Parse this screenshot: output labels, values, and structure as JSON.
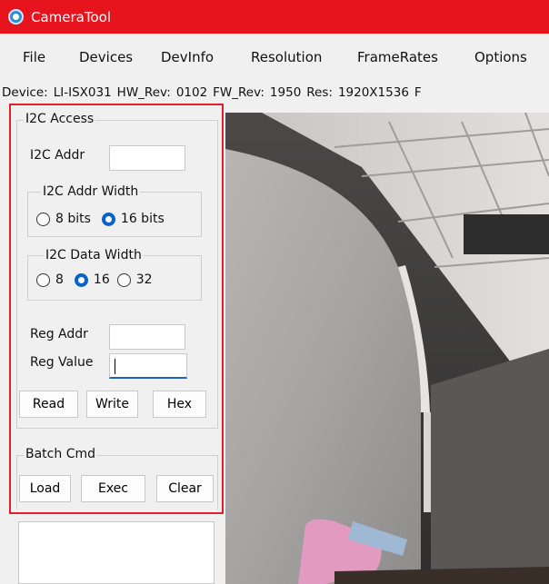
{
  "window": {
    "title": "CameraTool",
    "accent_color": "#e8141d"
  },
  "menu": [
    "File",
    "Devices",
    "DevInfo",
    "Resolution",
    "FrameRates",
    "Options"
  ],
  "info_bar": [
    "Device:",
    "LI-ISX031",
    "HW_Rev:",
    "0102",
    "FW_Rev:",
    "1950",
    "Res:",
    "1920X1536",
    "F"
  ],
  "i2c": {
    "legend": "I2C Access",
    "addr_label": "I2C Addr",
    "addr_value": "",
    "addr_width": {
      "legend": "I2C Addr Width",
      "options": [
        "8 bits",
        "16 bits"
      ],
      "selected": "16 bits"
    },
    "data_width": {
      "legend": "I2C Data Width",
      "options": [
        "8",
        "16",
        "32"
      ],
      "selected": "16"
    },
    "reg_addr_label": "Reg Addr",
    "reg_addr_value": "",
    "reg_value_label": "Reg Value",
    "reg_value_value": "",
    "buttons": {
      "read": "Read",
      "write": "Write",
      "hex": "Hex"
    }
  },
  "batch": {
    "legend": "Batch Cmd",
    "buttons": {
      "load": "Load",
      "exec": "Exec",
      "clear": "Clear"
    }
  },
  "icons": {
    "app": "app-icon"
  },
  "colors": {
    "highlight_border": "#e0202a",
    "radio_selected": "#0a62c9"
  }
}
